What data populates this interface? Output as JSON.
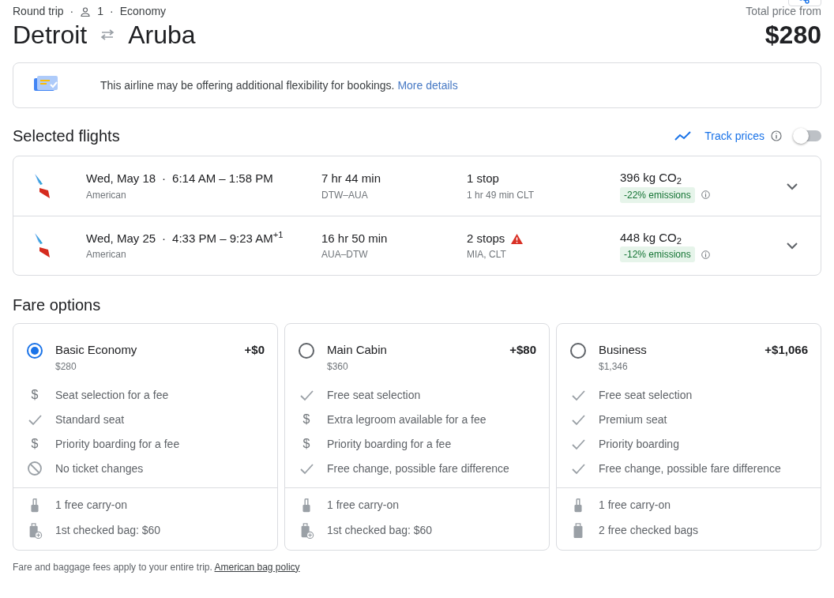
{
  "header": {
    "trip_type": "Round trip",
    "separators": [
      "·",
      "·"
    ],
    "passengers": "1",
    "cabin": "Economy",
    "origin": "Detroit",
    "destination": "Aruba",
    "price_label": "Total price from",
    "price": "$280"
  },
  "notice": {
    "text": "This airline may be offering additional flexibility for bookings.",
    "link": "More details"
  },
  "selected_flights": {
    "title": "Selected flights",
    "track_prices": {
      "label": "Track prices",
      "on": false
    },
    "flights": [
      {
        "date": "Wed, May 18",
        "separator": "·",
        "times": "6:14 AM – 1:58 PM",
        "airline": "American",
        "duration": "7 hr 44 min",
        "route": "DTW–AUA",
        "stops": "1 stop",
        "warning": false,
        "stop_detail": "1 hr 49 min CLT",
        "emissions": "396 kg CO$_{2}$",
        "emissions_delta": "-22% emissions"
      },
      {
        "date": "Wed, May 25",
        "separator": "·",
        "times": "4:33 PM – 9:23 AM$^{+1}$",
        "airline": "American",
        "duration": "16 hr 50 min",
        "route": "AUA–DTW",
        "stops": "2 stops",
        "warning": true,
        "stop_detail": "MIA, CLT",
        "emissions": "448 kg CO$_{2}$",
        "emissions_delta": "-12% emissions"
      }
    ]
  },
  "fare_options": {
    "title": "Fare options",
    "options": [
      {
        "name": "Basic Economy",
        "price": "$280",
        "extra": "+$0",
        "selected": true,
        "features": [
          {
            "kind": "fee",
            "icon": "$",
            "text": "Seat selection for a fee"
          },
          {
            "kind": "included",
            "text": "Standard seat"
          },
          {
            "kind": "fee",
            "icon": "$",
            "text": "Priority boarding for a fee"
          },
          {
            "kind": "none",
            "text": "No ticket changes"
          }
        ],
        "baggage": [
          {
            "kind": "carry_on",
            "text": "1 free carry-on"
          },
          {
            "kind": "checked_fee",
            "text": "1st checked bag: $60"
          }
        ]
      },
      {
        "name": "Main Cabin",
        "price": "$360",
        "extra": "+$80",
        "selected": false,
        "features": [
          {
            "kind": "included",
            "text": "Free seat selection"
          },
          {
            "kind": "fee",
            "icon": "$",
            "text": "Extra legroom available for a fee"
          },
          {
            "kind": "fee",
            "icon": "$",
            "text": "Priority boarding for a fee"
          },
          {
            "kind": "included",
            "text": "Free change, possible fare difference"
          }
        ],
        "baggage": [
          {
            "kind": "carry_on",
            "text": "1 free carry-on"
          },
          {
            "kind": "checked_fee",
            "text": "1st checked bag: $60"
          }
        ]
      },
      {
        "name": "Business",
        "price": "$1,346",
        "extra": "+$1,066",
        "selected": false,
        "features": [
          {
            "kind": "included",
            "text": "Free seat selection"
          },
          {
            "kind": "included",
            "text": "Premium seat"
          },
          {
            "kind": "included",
            "text": "Priority boarding"
          },
          {
            "kind": "included",
            "text": "Free change, possible fare difference"
          }
        ],
        "baggage": [
          {
            "kind": "carry_on",
            "text": "1 free carry-on"
          },
          {
            "kind": "checked",
            "text": "2 free checked bags"
          }
        ]
      }
    ]
  },
  "footer": {
    "text": "Fare and baggage fees apply to your entire trip.",
    "link": "American bag policy"
  }
}
